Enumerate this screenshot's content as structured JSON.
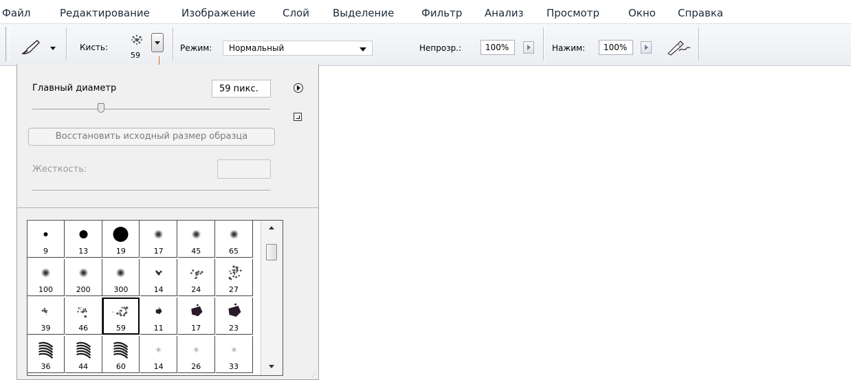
{
  "menu": [
    "Файл",
    "Редактирование",
    "Изображение",
    "Слой",
    "Выделение",
    "Фильтр",
    "Анализ",
    "Просмотр",
    "Окно",
    "Справка"
  ],
  "options_bar": {
    "brush_label": "Кисть:",
    "brush_size": "59",
    "mode_label": "Режим:",
    "mode_value": "Нормальный",
    "opacity_label": "Непрозр.:",
    "opacity_value": "100%",
    "flow_label": "Нажим:",
    "flow_value": "100%",
    "tool_icon": "brush-icon",
    "airbrush_icon": "airbrush-icon"
  },
  "brush_panel": {
    "master_diameter_label": "Главный диаметр",
    "master_diameter_value": "59 пикс.",
    "master_diameter_slider_fraction": 0.29,
    "restore_button": "Восстановить исходный размер образца",
    "hardness_label": "Жесткость:",
    "hardness_value": "",
    "selected_brush": "59",
    "brushes": [
      {
        "size": "9",
        "kind": "hard"
      },
      {
        "size": "13",
        "kind": "hard"
      },
      {
        "size": "19",
        "kind": "hard"
      },
      {
        "size": "17",
        "kind": "soft"
      },
      {
        "size": "45",
        "kind": "soft"
      },
      {
        "size": "65",
        "kind": "soft"
      },
      {
        "size": "100",
        "kind": "soft"
      },
      {
        "size": "200",
        "kind": "soft"
      },
      {
        "size": "300",
        "kind": "soft"
      },
      {
        "size": "14",
        "kind": "spatter"
      },
      {
        "size": "24",
        "kind": "spatter"
      },
      {
        "size": "27",
        "kind": "spatter"
      },
      {
        "size": "39",
        "kind": "spatter"
      },
      {
        "size": "46",
        "kind": "spatter"
      },
      {
        "size": "59",
        "kind": "spatter"
      },
      {
        "size": "11",
        "kind": "chalk"
      },
      {
        "size": "17",
        "kind": "chalk"
      },
      {
        "size": "23",
        "kind": "chalk"
      },
      {
        "size": "36",
        "kind": "charcoal"
      },
      {
        "size": "44",
        "kind": "charcoal"
      },
      {
        "size": "60",
        "kind": "charcoal"
      },
      {
        "size": "14",
        "kind": "star"
      },
      {
        "size": "26",
        "kind": "star"
      },
      {
        "size": "33",
        "kind": "star"
      }
    ]
  }
}
